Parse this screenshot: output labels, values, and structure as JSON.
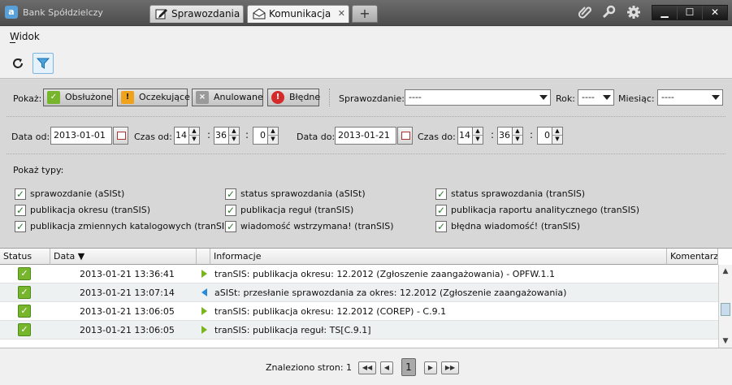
{
  "app": {
    "logo": "a",
    "title": "Bank Spółdzielczy"
  },
  "tabs": [
    {
      "label": "Sprawozdania",
      "icon": "edit-icon"
    },
    {
      "label": "Komunikacja",
      "icon": "envelope-icon",
      "close": "✕"
    }
  ],
  "new_tab": "+",
  "window_buttons": [
    "▁",
    "☐",
    "✕"
  ],
  "menu": {
    "widok": "Widok"
  },
  "filters": {
    "show_label": "Pokaż:",
    "status_buttons": [
      "Obsłużone",
      "Oczekujące",
      "Anulowane",
      "Błędne"
    ],
    "report_label": "Sprawozdanie:",
    "report_value": "----",
    "year_label": "Rok:",
    "year_value": "----",
    "month_label": "Miesiąc:",
    "month_value": "----",
    "date_from_label": "Data od:",
    "date_from": "2013-01-01",
    "time_from_label": "Czas od:",
    "time_from": [
      "14",
      "36",
      "0"
    ],
    "date_to_label": "Data do:",
    "date_to": "2013-01-21",
    "time_to_label": "Czas do:",
    "time_to": [
      "14",
      "36",
      "0"
    ],
    "types_label": "Pokaż typy:",
    "types": [
      "sprawozdanie (aSISt)",
      "status sprawozdania (aSISt)",
      "status sprawozdania (tranSIS)",
      "publikacja okresu (tranSIS)",
      "publikacja reguł (tranSIS)",
      "publikacja raportu analitycznego (tranSIS)",
      "publikacja zmiennych katalogowych (tranSIS)",
      "wiadomość wstrzymana! (tranSIS)",
      "błędna wiadomość! (tranSIS)"
    ]
  },
  "grid": {
    "columns": [
      "Status",
      "Data ▼",
      "Informacje",
      "Komentarz"
    ],
    "rows": [
      {
        "date": "2013-01-21 13:36:41",
        "direction": "in",
        "info": "tranSIS: publikacja okresu: 12.2012  (Zgłoszenie zaangażowania) - OPFW.1.1"
      },
      {
        "date": "2013-01-21 13:07:14",
        "direction": "out",
        "info": "aSISt: przesłanie sprawozdania za okres: 12.2012  (Zgłoszenie zaangażowania)"
      },
      {
        "date": "2013-01-21 13:06:05",
        "direction": "in",
        "info": "tranSIS: publikacja okresu: 12.2012  (COREP) - C.9.1"
      },
      {
        "date": "2013-01-21 13:06:05",
        "direction": "in",
        "info": "tranSIS: publikacja reguł: TS[C.9.1]"
      }
    ]
  },
  "footer": {
    "found_label": "Znaleziono stron: 1",
    "current_page": "1"
  }
}
